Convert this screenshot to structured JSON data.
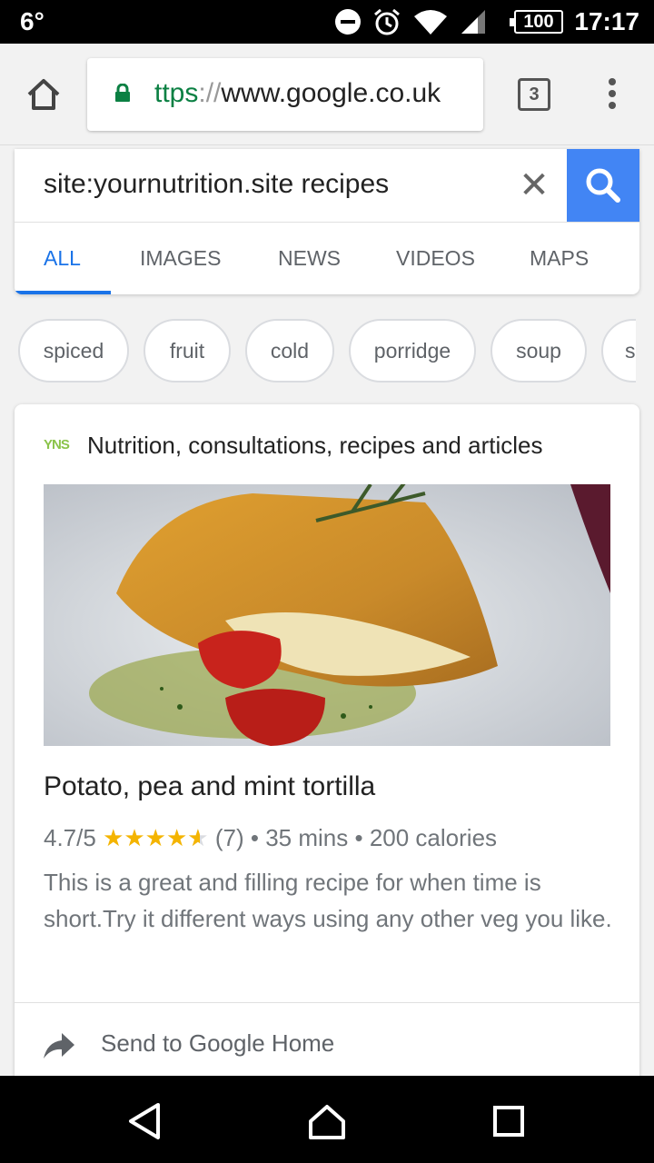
{
  "status_bar": {
    "temperature": "6°",
    "battery": "100",
    "time": "17:17",
    "icons": [
      "dnd-icon",
      "alarm-icon",
      "wifi-icon",
      "signal-icon"
    ]
  },
  "browser": {
    "url_scheme": "ttps",
    "url_sep": "://",
    "url_host": "www.google.co.uk",
    "tab_count": "3",
    "secure": true
  },
  "search": {
    "query": "site:yournutrition.site recipes",
    "clear_symbol": "✕",
    "accent": "#4285f4",
    "tabs": [
      {
        "label": "ALL",
        "active": true
      },
      {
        "label": "IMAGES",
        "active": false
      },
      {
        "label": "NEWS",
        "active": false
      },
      {
        "label": "VIDEOS",
        "active": false
      },
      {
        "label": "MAPS",
        "active": false
      }
    ]
  },
  "chips": [
    "spiced",
    "fruit",
    "cold",
    "porridge",
    "soup",
    "s"
  ],
  "result": {
    "favicon_text": "YNS",
    "source": "Nutrition, consultations, recipes and articles",
    "title": "Potato, pea and mint tortilla",
    "rating": "4.7/5",
    "stars": "★★★★",
    "half_star": "★",
    "rating_value": 4.7,
    "reviews": "(7)",
    "dot1": "•",
    "time": "35 mins",
    "dot2": "•",
    "calories": "200 calories",
    "description": "This is a great and filling recipe for when time is short.Try it different ways using any other veg you like.",
    "send_label": "Send to Google Home"
  }
}
